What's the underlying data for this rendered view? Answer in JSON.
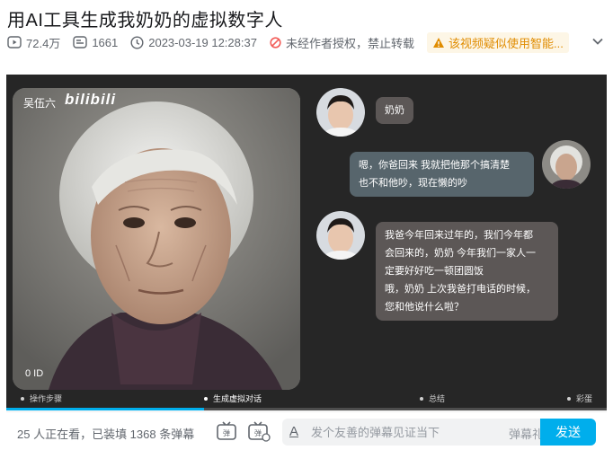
{
  "video": {
    "title": "用AI工具生成我奶奶的虚拟数字人",
    "views": "72.4万",
    "danmaku_count": "1661",
    "publish_time": "2023-03-19 12:28:37",
    "copyright_notice": "未经作者授权，禁止转载",
    "ai_warning": "该视频疑似使用智能..."
  },
  "player": {
    "uploader_watermark": "吴伍六",
    "brand_watermark": "bilibili",
    "frame_id": "0 ID",
    "chat": [
      {
        "speaker": "grandson",
        "text": "奶奶"
      },
      {
        "speaker": "grandma",
        "line1": "嗯，你爸回来 我就把他那个搞清楚",
        "line2": "也不和他吵，现在懒的吵"
      },
      {
        "speaker": "grandson",
        "line1": "我爸今年回来过年的，我们今年都",
        "line2": "会回来的，奶奶 今年我们一家人一",
        "line3": "定要好好吃一顿团圆饭",
        "line4": "哦，奶奶  上次我爸打电话的时候，",
        "line5": "您和他说什么啦？"
      }
    ],
    "chapters": [
      "操作步骤",
      "生成虚拟对话",
      "总结",
      "彩蛋"
    ],
    "progress_fraction": 0.33
  },
  "danmaku_bar": {
    "viewers_text": "25 人正在看，已装填 1368 条弹幕",
    "input_placeholder": "发个友善的弹幕见证当下",
    "etiquette_label": "弹幕礼仪 ›",
    "send_label": "发送"
  },
  "colors": {
    "accent": "#00aeec",
    "warning_text": "#e08c00",
    "warning_bg": "#fdf6e6",
    "player_bg": "#262626"
  },
  "icons": [
    "play-count-icon",
    "danmaku-count-icon",
    "clock-icon",
    "no-repost-icon",
    "warning-icon",
    "chevron-down-icon",
    "danmaku-toggle-icon",
    "danmaku-settings-icon",
    "text-style-icon"
  ]
}
